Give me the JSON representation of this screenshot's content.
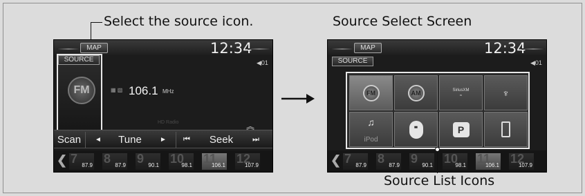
{
  "captions": {
    "left": "Select the source icon.",
    "right_title": "Source Select Screen",
    "bottom": "Source List Icons"
  },
  "screen": {
    "map_label": "MAP",
    "time": "12:34",
    "source_label": "SOURCE",
    "volume_label": "01"
  },
  "radio": {
    "band": "FM",
    "frequency": "106.1",
    "unit": "MHz",
    "hd_label": "HD Radio",
    "controls": {
      "scan": "Scan",
      "tune": "Tune",
      "seek": "Seek",
      "tune_down": "◄",
      "tune_up": "►",
      "seek_down": "⏮",
      "seek_up": "⏭"
    }
  },
  "presets": [
    {
      "num": "7",
      "freq": "87.9",
      "active": false
    },
    {
      "num": "8",
      "freq": "87.9",
      "active": false
    },
    {
      "num": "9",
      "freq": "90.1",
      "active": false
    },
    {
      "num": "10",
      "freq": "98.1",
      "active": false
    },
    {
      "num": "11",
      "freq": "106.1",
      "active": true
    },
    {
      "num": "12",
      "freq": "107.9",
      "active": false
    }
  ],
  "source_list": [
    {
      "name": "FM",
      "icon": "fm-icon",
      "selected": true
    },
    {
      "name": "AM",
      "icon": "am-icon",
      "selected": false
    },
    {
      "name": "SiriusXM",
      "icon": "siriusxm-icon",
      "selected": false
    },
    {
      "name": "USB",
      "icon": "usb-icon",
      "selected": false
    },
    {
      "name": "iPod",
      "icon": "ipod-icon",
      "selected": false
    },
    {
      "name": "Bluetooth",
      "icon": "bluetooth-icon",
      "selected": false
    },
    {
      "name": "P",
      "icon": "pandora-icon",
      "selected": false
    },
    {
      "name": "Phone",
      "icon": "phone-icon",
      "selected": false
    }
  ],
  "colors": {
    "screen_bg": "#1c1c1c",
    "highlight": "#e8e8e8",
    "page_bg": "#dcdcdc"
  }
}
